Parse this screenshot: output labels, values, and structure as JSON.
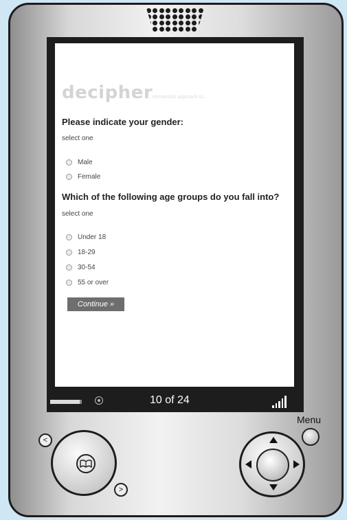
{
  "survey": {
    "brand": "decipher",
    "tagline": "Humanistic approach to...",
    "question1": "Please indicate your gender:",
    "q1_instruction": "select one",
    "q1_options": [
      "Male",
      "Female"
    ],
    "question2": "Which of the following age groups do you fall into?",
    "q2_instruction": "select one",
    "q2_options": [
      "Under 18",
      "18-29",
      "30-54",
      "55 or over"
    ],
    "continue_label": "Continue »"
  },
  "device": {
    "page_indicator": "10 of 24",
    "menu_label": "Menu",
    "prev_label": "<",
    "next_label": ">"
  }
}
